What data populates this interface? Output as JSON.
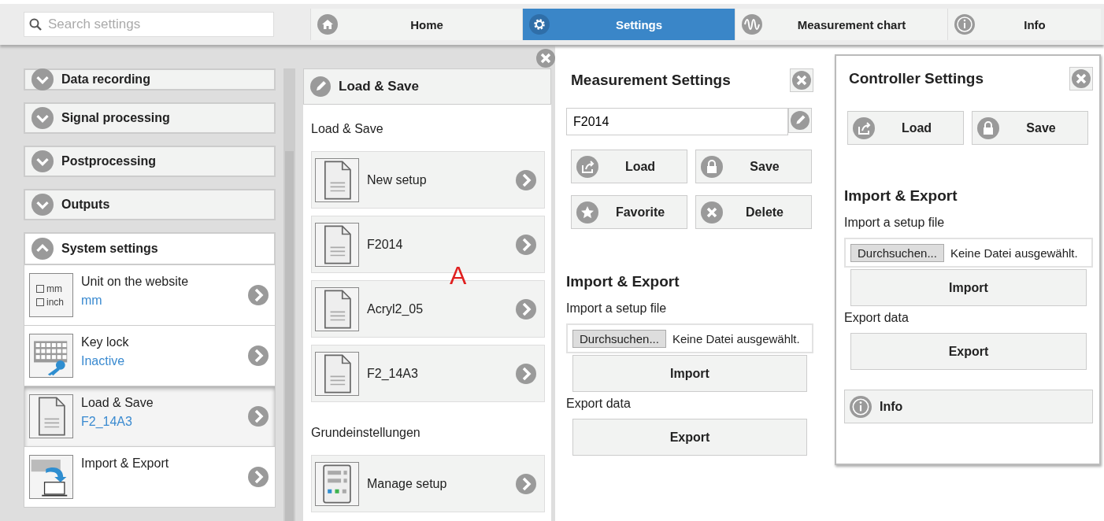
{
  "search": {
    "placeholder": "Search settings"
  },
  "nav_tabs": [
    {
      "label": "Home",
      "kind": "home",
      "selected": false
    },
    {
      "label": "Settings",
      "kind": "gear",
      "selected": true
    },
    {
      "label": "Measurement chart",
      "kind": "wave",
      "selected": false
    },
    {
      "label": "Info",
      "kind": "info",
      "selected": false
    }
  ],
  "sidebar": {
    "sections": [
      {
        "label": "Data recording",
        "expanded": false
      },
      {
        "label": "Signal processing",
        "expanded": false
      },
      {
        "label": "Postprocessing",
        "expanded": false
      },
      {
        "label": "Outputs",
        "expanded": false
      },
      {
        "label": "System settings",
        "expanded": true,
        "items": [
          {
            "kind": "unit",
            "title": "Unit on the website",
            "value": "mm",
            "selected": false,
            "icon_labels": [
              "mm",
              "inch"
            ]
          },
          {
            "kind": "keylock",
            "title": "Key lock",
            "value": "Inactive",
            "selected": false
          },
          {
            "kind": "file",
            "title": "Load & Save",
            "value": "F2_14A3",
            "selected": true
          },
          {
            "kind": "import",
            "title": "Import & Export",
            "selected": false
          }
        ]
      }
    ]
  },
  "load_save_panel": {
    "title": "Load & Save",
    "groups": [
      {
        "heading": "Load & Save",
        "items": [
          {
            "kind": "file",
            "label": "New setup"
          },
          {
            "kind": "file",
            "label": "F2014"
          },
          {
            "kind": "file",
            "label": "Acryl2_05"
          },
          {
            "kind": "file",
            "label": "F2_14A3"
          }
        ]
      },
      {
        "heading": "Grundeinstellungen",
        "items": [
          {
            "kind": "manage",
            "label": "Manage setup"
          }
        ]
      }
    ]
  },
  "annotation": "A",
  "measurement_settings": {
    "title": "Measurement Settings",
    "name_value": "F2014",
    "buttons": [
      {
        "label": "Load",
        "kind": "load"
      },
      {
        "label": "Save",
        "kind": "lock"
      },
      {
        "label": "Favorite",
        "kind": "star"
      },
      {
        "label": "Delete",
        "kind": "delete"
      }
    ],
    "import_export": {
      "heading": "Import & Export",
      "import_label": "Import a setup file",
      "browse_button": "Durchsuchen...",
      "file_status": "Keine Datei ausgewählt.",
      "import_button": "Import",
      "export_label": "Export data",
      "export_button": "Export"
    }
  },
  "controller_settings": {
    "title": "Controller Settings",
    "buttons": [
      {
        "label": "Load",
        "kind": "load"
      },
      {
        "label": "Save",
        "kind": "lock"
      }
    ],
    "import_export": {
      "heading": "Import & Export",
      "import_label": "Import a setup file",
      "browse_button": "Durchsuchen...",
      "file_status": "Keine Datei ausgewählt.",
      "import_button": "Import",
      "export_label": "Export data",
      "export_button": "Export"
    },
    "info_button": "Info"
  }
}
